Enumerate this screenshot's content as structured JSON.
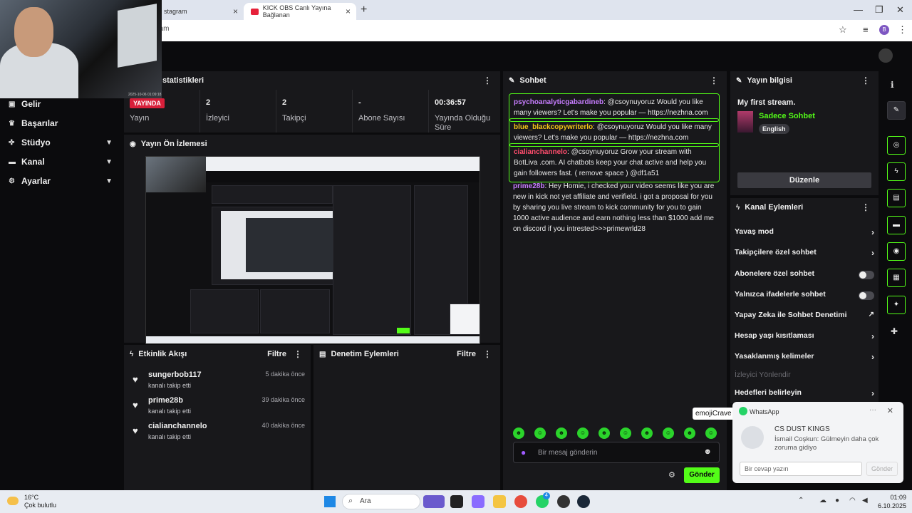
{
  "browser": {
    "tabs": [
      {
        "label": "stagram"
      },
      {
        "label": "KICK OBS Canlı Yayına Bağlanan"
      }
    ],
    "address": "eam",
    "profile_initial": "B",
    "window_controls": [
      "—",
      "❐",
      "✕"
    ]
  },
  "webcam": {
    "timestamp": "2025-10-06 01:09:18"
  },
  "sidebar": {
    "items": [
      {
        "label": "Gelir",
        "icon": "dollar-icon",
        "chevron": false
      },
      {
        "label": "Başarılar",
        "icon": "trophy-icon",
        "chevron": false
      },
      {
        "label": "Stüdyo",
        "icon": "studio-icon",
        "chevron": true
      },
      {
        "label": "Kanal",
        "icon": "channel-icon",
        "chevron": true
      },
      {
        "label": "Ayarlar",
        "icon": "gear-icon",
        "chevron": true
      }
    ]
  },
  "stats": {
    "title": "statistikleri",
    "badge": "YAYINDA",
    "items": [
      {
        "value": "",
        "label": "Yayın"
      },
      {
        "value": "2",
        "label": "İzleyici"
      },
      {
        "value": "2",
        "label": "Takipçi"
      },
      {
        "value": "-",
        "label": "Abone Sayısı"
      },
      {
        "value": "00:36:57",
        "label": "Yayında Olduğu Süre"
      }
    ]
  },
  "preview": {
    "title": "Yayın Ön İzlemesi"
  },
  "events": {
    "title": "Etkinlik Akışı",
    "filter": "Filtre",
    "items": [
      {
        "name": "sungerbob117",
        "action": "kanalı takip etti",
        "time": "5 dakika önce"
      },
      {
        "name": "prime28b",
        "action": "kanalı takip etti",
        "time": "39 dakika önce"
      },
      {
        "name": "cialianchannelo",
        "action": "kanalı takip etti",
        "time": "40 dakika önce"
      }
    ]
  },
  "moderation": {
    "title": "Denetim Eylemleri",
    "filter": "Filtre"
  },
  "chat": {
    "title": "Sohbet",
    "messages": [
      {
        "user": "psychoanalyticgabardineb",
        "user_color": "#c77dff",
        "text": ": @csoynuyoruz Would you like many viewers? Let's make you popular — https://nezhna.com",
        "highlight": true
      },
      {
        "user": "blue_blackcopywriterlo",
        "user_color": "#f5c518",
        "text": ": @csoynuyoruz Would you like many viewers? Let's make you popular — https://nezhna.com",
        "highlight": true
      },
      {
        "user": "cialianchannelo",
        "user_color": "#ff4d6d",
        "text": ": @csoynuyoruz Grow your stream with BotLiva .com. AI chatbots keep your chat active and help you gain followers fast. ( remove space ) @df1a51",
        "highlight": true
      },
      {
        "user": "prime28b",
        "user_color": "#c77dff",
        "text": ": Hey Homie, i checked your video seems like you are new in kick not yet affiliate and verifield. i got a proposal for you by sharing you live stream to kick community for you to gain 1000 active audience and earn nothing less than $1000 add me on discord if you intrested>>>primewrld28",
        "highlight": false
      }
    ],
    "emote_tooltip": "emojiCrave",
    "input_placeholder": "Bir mesaj gönderin",
    "send_label": "Gönder"
  },
  "stream_info": {
    "title": "Yayın bilgisi",
    "stream_title": "My first stream.",
    "category": "Sadece Sohbet",
    "tag": "English",
    "edit_label": "Düzenle"
  },
  "channel_actions": {
    "title": "Kanal Eylemleri",
    "items": [
      {
        "label": "Yavaş mod",
        "control": "arrow"
      },
      {
        "label": "Takipçilere özel sohbet",
        "control": "arrow"
      },
      {
        "label": "Abonelere özel sohbet",
        "control": "toggle"
      },
      {
        "label": "Yalnızca ifadelerle sohbet",
        "control": "toggle"
      },
      {
        "label": "Yapay Zeka ile Sohbet Denetimi",
        "control": "external"
      },
      {
        "label": "Hesap yaşı kısıtlaması",
        "control": "arrow"
      },
      {
        "label": "Yasaklanmış kelimeler",
        "control": "arrow"
      },
      {
        "label": "İzleyici Yönlendir",
        "control": "none",
        "disabled": true
      },
      {
        "label": "Hedefleri belirleyin",
        "control": "arrow"
      }
    ]
  },
  "whatsapp": {
    "app": "WhatsApp",
    "group": "CS DUST KINGS",
    "message": "İsmail Coşkun: Gülmeyin daha çok zoruma gidiyo",
    "reply_placeholder": "Bir cevap yazın",
    "send_label": "Gönder"
  },
  "taskbar": {
    "temperature": "16°C",
    "weather": "Çok bulutlu",
    "search": "Ara",
    "time": "01:09",
    "date": "6.10.2025",
    "notification_count": "4"
  },
  "colors": {
    "accent": "#53fc18",
    "live": "#d81f3a",
    "panel": "#18181b"
  }
}
